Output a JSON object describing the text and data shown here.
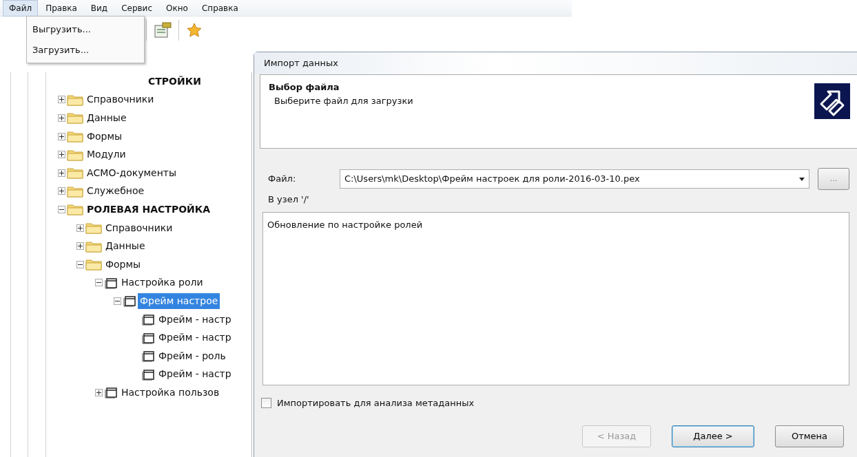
{
  "menu_bar": [
    {
      "label": "Файл",
      "selected": true
    },
    {
      "label": "Правка",
      "selected": false
    },
    {
      "label": "Вид",
      "selected": false
    },
    {
      "label": "Сервис",
      "selected": false
    },
    {
      "label": "Окно",
      "selected": false
    },
    {
      "label": "Справка",
      "selected": false
    }
  ],
  "file_menu": {
    "items": [
      "Выгрузить...",
      "Загрузить..."
    ]
  },
  "tree": {
    "root_label": "СТРОЙКИ",
    "items": [
      {
        "label": "Справочники",
        "kind": "folder",
        "bold": false,
        "expanded": false,
        "selected": false
      },
      {
        "label": "Данные",
        "kind": "folder",
        "bold": false,
        "expanded": false,
        "selected": false
      },
      {
        "label": "Формы",
        "kind": "folder",
        "bold": false,
        "expanded": false,
        "selected": false
      },
      {
        "label": "Модули",
        "kind": "folder",
        "bold": false,
        "expanded": false,
        "selected": false
      },
      {
        "label": "АСМО-документы",
        "kind": "folder",
        "bold": false,
        "expanded": false,
        "selected": false
      },
      {
        "label": "Служебное",
        "kind": "folder",
        "bold": false,
        "expanded": false,
        "selected": false
      },
      {
        "label": "РОЛЕВАЯ НАСТРОЙКА",
        "kind": "folder",
        "bold": true,
        "expanded": true,
        "selected": false,
        "children": [
          {
            "label": "Справочники",
            "kind": "folder",
            "bold": false,
            "expanded": false,
            "selected": false
          },
          {
            "label": "Данные",
            "kind": "folder",
            "bold": false,
            "expanded": false,
            "selected": false
          },
          {
            "label": "Формы",
            "kind": "folder",
            "bold": false,
            "expanded": true,
            "selected": false,
            "children": [
              {
                "label": "Настройка роли",
                "kind": "form",
                "bold": false,
                "expanded": true,
                "selected": false,
                "children": [
                  {
                    "label": "Фрейм настрое",
                    "kind": "form",
                    "bold": false,
                    "expanded": true,
                    "selected": true,
                    "children": [
                      {
                        "label": "Фрейм - настр",
                        "kind": "form",
                        "bold": false,
                        "selected": false
                      },
                      {
                        "label": "Фрейм - настр",
                        "kind": "form",
                        "bold": false,
                        "selected": false
                      },
                      {
                        "label": "Фрейм - роль",
                        "kind": "form",
                        "bold": false,
                        "selected": false
                      },
                      {
                        "label": "Фрейм - настр",
                        "kind": "form",
                        "bold": false,
                        "selected": false
                      }
                    ]
                  }
                ]
              },
              {
                "label": "Настройка пользов",
                "kind": "form",
                "bold": false,
                "expanded": false,
                "selected": false
              }
            ]
          }
        ]
      }
    ]
  },
  "dialog": {
    "title": "Импорт данных",
    "heading": "Выбор файла",
    "subheading": "Выберите файл для загрузки",
    "file_label": "Файл:",
    "file_value": "C:\\Users\\mk\\Desktop\\Фрейм настроек для роли-2016-03-10.pex",
    "browse_button": "...",
    "node_label": "В узел '/'",
    "comment": "Обновление по настройке ролей",
    "metadata_checkbox": {
      "label": "Импортировать для анализа метаданных",
      "checked": false
    },
    "buttons": [
      {
        "label": "< Назад",
        "disabled": true,
        "default": false
      },
      {
        "label": "Далее >",
        "disabled": false,
        "default": true
      },
      {
        "label": "Отмена",
        "disabled": false,
        "default": false
      }
    ]
  }
}
